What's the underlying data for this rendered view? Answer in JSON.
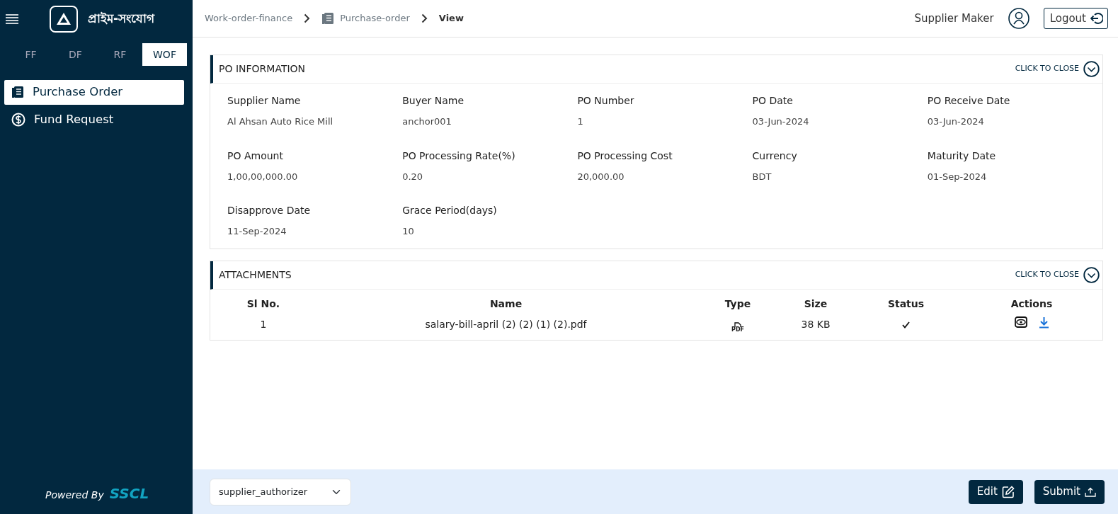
{
  "brand": {
    "name": "প্রাইম-সংযোগ"
  },
  "sidebar": {
    "tabs": [
      {
        "label": "FF",
        "selected": false
      },
      {
        "label": "DF",
        "selected": false
      },
      {
        "label": "RF",
        "selected": false
      },
      {
        "label": "WOF",
        "selected": true
      }
    ],
    "items": [
      {
        "label": "Purchase Order",
        "kind": "document",
        "selected": true
      },
      {
        "label": "Fund Request",
        "kind": "dollar",
        "selected": false
      }
    ],
    "footer": {
      "prefix": "Powered By",
      "company": "SSCL"
    }
  },
  "breadcrumb": [
    {
      "label": "Work-order-finance",
      "kind": "link"
    },
    {
      "label": "Purchase-order",
      "kind": "link-icon"
    },
    {
      "label": "View",
      "kind": "current"
    }
  ],
  "user": {
    "name": "Supplier Maker",
    "logout": "Logout"
  },
  "po_information": {
    "title": "PO INFORMATION",
    "toggle": "CLICK TO CLOSE",
    "expanded": true,
    "fields": [
      {
        "label": "Supplier Name",
        "value": "Al Ahsan Auto Rice Mill"
      },
      {
        "label": "Buyer Name",
        "value": "anchor001"
      },
      {
        "label": "PO Number",
        "value": "1"
      },
      {
        "label": "PO Date",
        "value": "03-Jun-2024"
      },
      {
        "label": "PO Receive Date",
        "value": "03-Jun-2024"
      },
      {
        "label": "PO Amount",
        "value": "1,00,00,000.00"
      },
      {
        "label": "PO Processing Rate(%)",
        "value": "0.20"
      },
      {
        "label": "PO Processing Cost",
        "value": "20,000.00"
      },
      {
        "label": "Currency",
        "value": "BDT"
      },
      {
        "label": "Maturity Date",
        "value": "01-Sep-2024"
      },
      {
        "label": "Disapprove Date",
        "value": "11-Sep-2024"
      },
      {
        "label": "Grace Period(days)",
        "value": "10"
      }
    ]
  },
  "attachments": {
    "title": "ATTACHMENTS",
    "toggle": "CLICK TO CLOSE",
    "expanded": true,
    "columns": [
      "Sl No.",
      "Name",
      "Type",
      "Size",
      "Status",
      "Actions"
    ],
    "rows": [
      {
        "sl": "1",
        "name": "salary-bill-april (2) (2) (1) (2).pdf",
        "type": "PDF",
        "size": "38 KB",
        "verified": true
      }
    ]
  },
  "footer_bar": {
    "role_select": "supplier_authorizer",
    "buttons": [
      {
        "label": "Edit",
        "kind": "edit"
      },
      {
        "label": "Submit",
        "kind": "submit"
      }
    ]
  }
}
